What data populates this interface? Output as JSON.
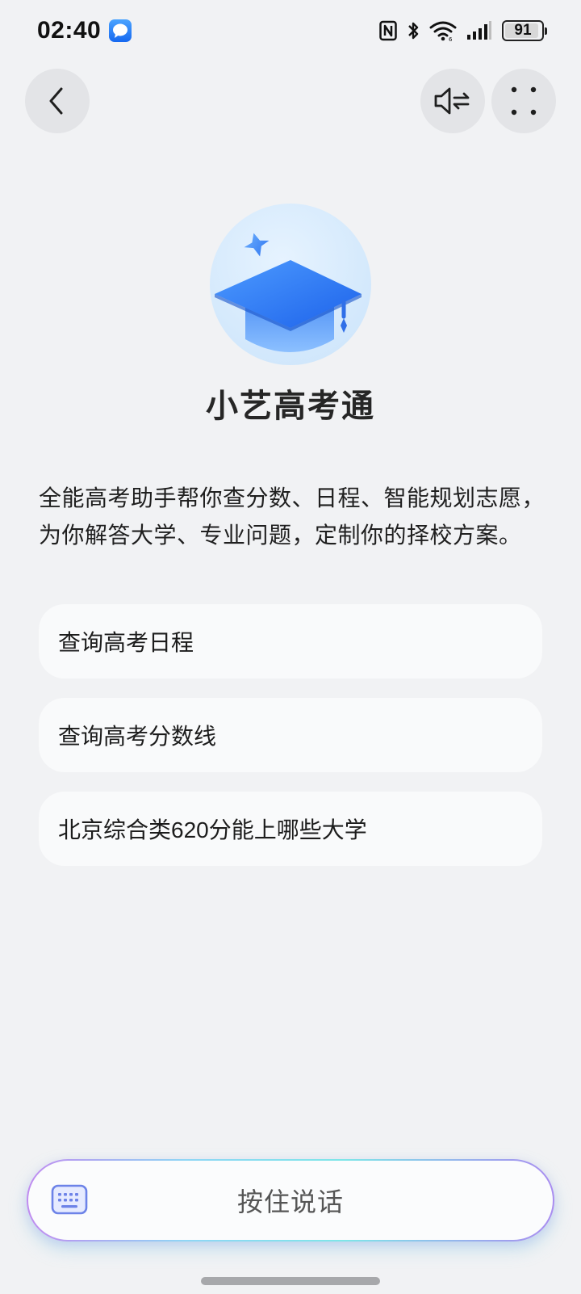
{
  "status_bar": {
    "time": "02:40",
    "battery": "91",
    "icons": [
      "message-icon",
      "nfc-icon",
      "bluetooth-icon",
      "wifi-icon",
      "signal-icon",
      "battery-icon"
    ]
  },
  "header": {
    "back_icon": "chevron-left-icon",
    "sound_icon": "speaker-switch-icon",
    "more_icon": "four-dots-icon"
  },
  "app": {
    "logo_icon": "graduation-cap-icon",
    "title": "小艺高考通",
    "description": "全能高考助手帮你查分数、日程、智能规划志愿，为你解答大学、专业问题，定制你的择校方案。"
  },
  "suggestions": [
    {
      "label": "查询高考日程"
    },
    {
      "label": "查询高考分数线"
    },
    {
      "label": "北京综合类620分能上哪些大学"
    }
  ],
  "input_bar": {
    "keyboard_icon": "keyboard-icon",
    "label": "按住说话"
  },
  "colors": {
    "background": "#f1f2f4",
    "card": "#f9fafb",
    "accent_blue": "#2f7bf5"
  }
}
